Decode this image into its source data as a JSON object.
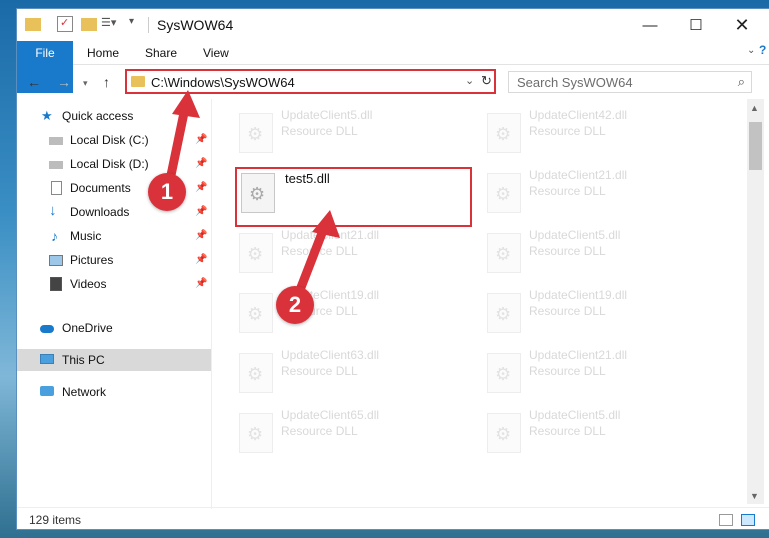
{
  "window": {
    "title": "SysWOW64"
  },
  "ribbon": {
    "tabs": [
      "File",
      "Home",
      "Share",
      "View"
    ]
  },
  "address": {
    "path": "C:\\Windows\\SysWOW64",
    "search_placeholder": "Search SysWOW64"
  },
  "nav_pane": {
    "items": [
      {
        "label": "Quick access",
        "icon": "star-icon"
      },
      {
        "label": "Local Disk (C:)",
        "icon": "drive-icon",
        "pinned": true
      },
      {
        "label": "Local Disk (D:)",
        "icon": "drive-icon",
        "pinned": true
      },
      {
        "label": "Documents",
        "icon": "documents-icon",
        "pinned": true
      },
      {
        "label": "Downloads",
        "icon": "download-icon",
        "pinned": true
      },
      {
        "label": "Music",
        "icon": "music-icon",
        "pinned": true
      },
      {
        "label": "Pictures",
        "icon": "pictures-icon",
        "pinned": true
      },
      {
        "label": "Videos",
        "icon": "videos-icon",
        "pinned": true
      },
      {
        "label": "OneDrive",
        "icon": "cloud-icon"
      },
      {
        "label": "This PC",
        "icon": "computer-icon",
        "selected": true
      },
      {
        "label": "Network",
        "icon": "network-icon"
      }
    ]
  },
  "files": {
    "left": [
      {
        "name": "UpdateClient5.dll",
        "type": "Resource DLL"
      },
      {
        "name": "test5.dll",
        "type": "",
        "highlighted": true
      },
      {
        "name": "UpdateClient21.dll",
        "type": "Resource DLL"
      },
      {
        "name": "UpdateClient19.dll",
        "type": "Resource DLL"
      },
      {
        "name": "UpdateClient63.dll",
        "type": "Resource DLL"
      },
      {
        "name": "UpdateClient65.dll",
        "type": "Resource DLL"
      }
    ],
    "right": [
      {
        "name": "UpdateClient42.dll",
        "type": "Resource DLL"
      },
      {
        "name": "UpdateClient21.dll",
        "type": "Resource DLL"
      },
      {
        "name": "UpdateClient5.dll",
        "type": "Resource DLL"
      },
      {
        "name": "UpdateClient19.dll",
        "type": "Resource DLL"
      },
      {
        "name": "UpdateClient21.dll",
        "type": "Resource DLL"
      },
      {
        "name": "UpdateClient5.dll",
        "type": "Resource DLL"
      }
    ]
  },
  "status": {
    "item_count": "129 items"
  },
  "annotations": {
    "step1": "1",
    "step2": "2",
    "color": "#d9323a"
  }
}
